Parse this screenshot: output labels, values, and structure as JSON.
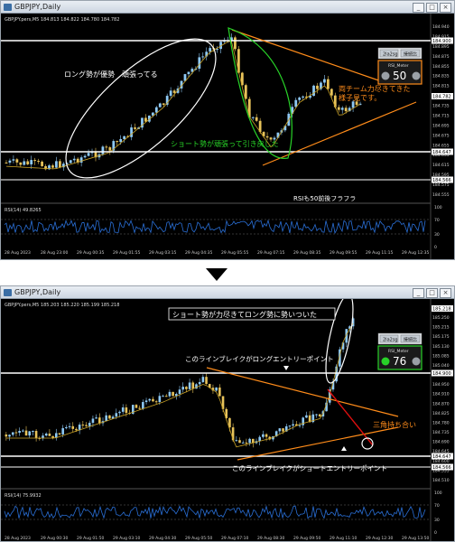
{
  "colors": {
    "background": "#000000",
    "candle_up": "#8ec9f5",
    "candle_down": "#e8c35a",
    "ma_line": "#c9a227",
    "ann_white": "#ffffff",
    "ann_green": "#28d228",
    "ann_orange": "#ff8c1a",
    "ann_red": "#e01010",
    "rsi_line": "#2a6fd6"
  },
  "top": {
    "title": "GBPJPY,Daily",
    "symbol_info": "GBPJPY.pers,M5  184.813 184.822 184.780 184.782",
    "price_badge": "184.782",
    "price_ticks": [
      "184.940",
      "184.915",
      "184.895",
      "184.875",
      "184.855",
      "184.835",
      "184.815",
      "184.795",
      "184.735",
      "184.715",
      "184.695",
      "184.675",
      "184.655",
      "184.635",
      "184.615",
      "184.595",
      "184.575",
      "184.555"
    ],
    "level_labels": [
      "184.900",
      "184.647",
      "184.566"
    ],
    "rsi_label": "RSI(14) 49.8265",
    "rsi_ticks": [
      "100",
      "70",
      "30",
      "0"
    ],
    "time_ticks": [
      "28 Aug 2023",
      "28 Aug 23:00",
      "29 Aug 00:35",
      "29 Aug 01:55",
      "29 Aug 03:15",
      "29 Aug 04:35",
      "29 Aug 05:55",
      "29 Aug 07:15",
      "29 Aug 08:35",
      "29 Aug 09:55",
      "29 Aug 11:15",
      "29 Aug 12:35"
    ],
    "panel": {
      "btn1": "2la2sg",
      "btn2": "接続比",
      "meter_label": "RSI_Meter",
      "meter_value": "50"
    },
    "annotations": {
      "long": "ロング勢が優勢　頑張ってる",
      "short": "ショート勢が頑張って引き戻した",
      "both": "両チーム力尽きてきた\n様子見です。",
      "rsi": "RSIも50前後フラフラ"
    }
  },
  "bottom": {
    "title": "GBPJPY,Daily",
    "symbol_info": "GBPJPY.pers,M5  185.203 185.220 185.199 185.218",
    "price_badge": "185.218",
    "price_ticks": [
      "185.250",
      "185.215",
      "185.175",
      "185.130",
      "185.085",
      "185.040",
      "184.995",
      "184.950",
      "184.910",
      "184.870",
      "184.825",
      "184.780",
      "184.735",
      "184.690",
      "184.645",
      "184.600",
      "184.555",
      "184.510"
    ],
    "level_labels": [
      "184.900",
      "184.647",
      "184.566"
    ],
    "rsi_label": "RSI(14) 75.9932",
    "rsi_ticks": [
      "100",
      "70",
      "30",
      "0"
    ],
    "time_ticks": [
      "28 Aug 2023",
      "29 Aug 00:30",
      "29 Aug 01:50",
      "29 Aug 03:10",
      "29 Aug 04:30",
      "29 Aug 05:50",
      "29 Aug 07:10",
      "29 Aug 08:30",
      "29 Aug 09:50",
      "29 Aug 11:10",
      "29 Aug 12:30",
      "29 Aug 13:50"
    ],
    "panel": {
      "btn1": "2la2sg",
      "btn2": "接続比",
      "meter_label": "RSI_Meter",
      "meter_value": "76"
    },
    "annotations": {
      "title": "ショート勢が力尽きてロング勢に勢いついた",
      "long_entry": "このラインブレイクがロングエントリーポイント",
      "triangle": "三角持ち合い",
      "short_entry": "このラインブレイクがショートエントリーポイント"
    }
  }
}
